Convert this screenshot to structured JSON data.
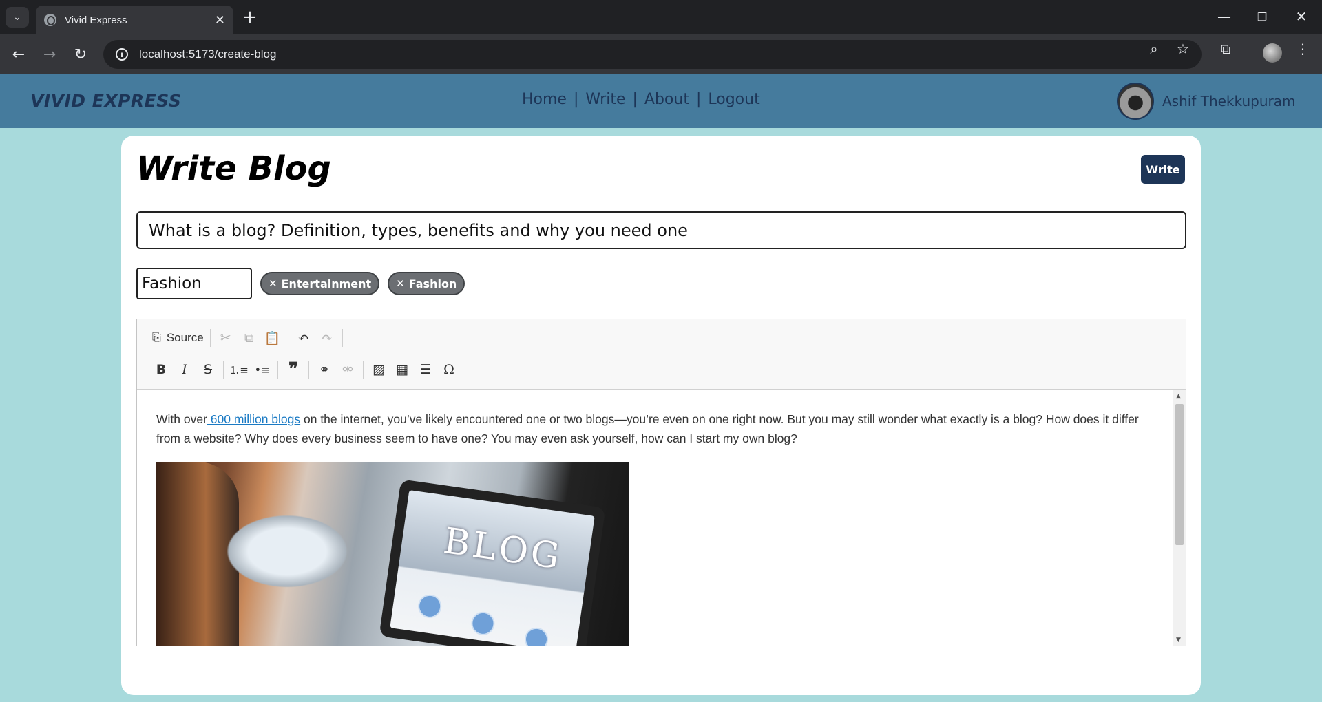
{
  "browser": {
    "tab_title": "Vivid Express",
    "url": "localhost:5173/create-blog"
  },
  "site": {
    "logo": "VIVID EXPRESS",
    "nav": [
      {
        "label": "Home"
      },
      {
        "label": "Write"
      },
      {
        "label": "About"
      },
      {
        "label": "Logout"
      }
    ],
    "nav_separator": "|",
    "user_name": "Ashif Thekkupuram"
  },
  "page": {
    "title": "Write Blog",
    "write_button": "Write",
    "blog_title_value": "What is a blog? Definition, types, benefits and why you need one",
    "tag_input_value": "Fashion",
    "tags": [
      "Entertainment",
      "Fashion"
    ]
  },
  "editor": {
    "source_label": "Source",
    "content": {
      "text_before_link": "With over",
      "link_text": " 600 million blogs",
      "text_after_link": " on the internet, you’ve likely encountered one or two blogs—you’re even on one right now. But you may still wonder what exactly is a blog? How does it differ from a website? Why does every business seem to have one? You may even ask yourself, how can I start my own blog?",
      "image_caption_text": "BLOG"
    }
  }
}
